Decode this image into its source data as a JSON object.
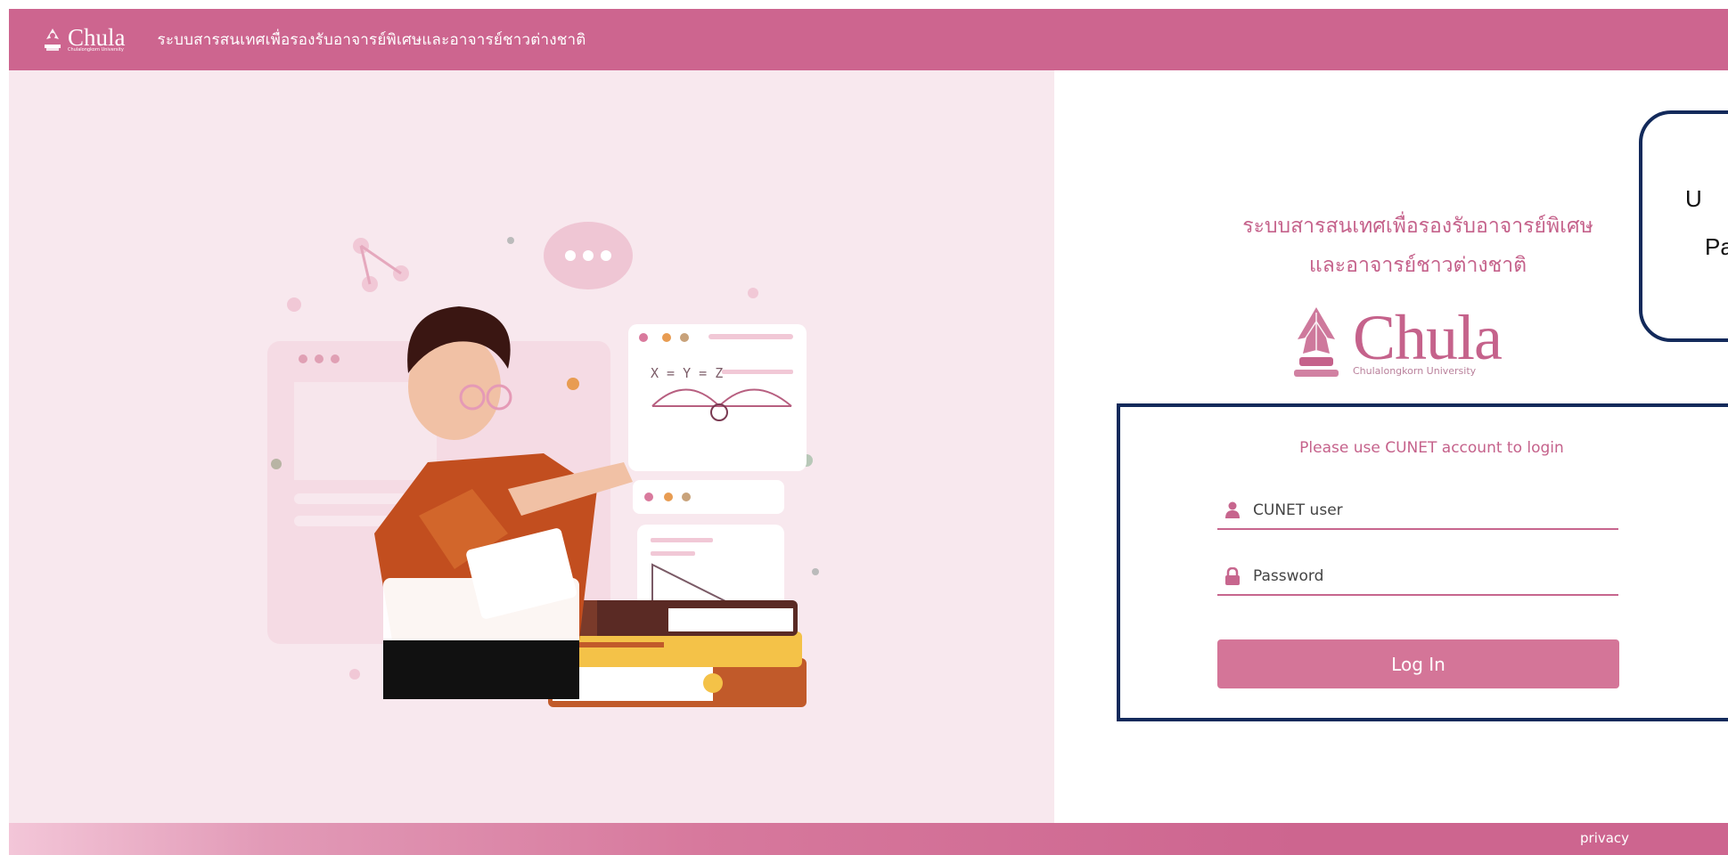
{
  "header": {
    "logo_text": "Chula",
    "logo_subtext": "Chulalongkorn University",
    "title": "ระบบสารสนเทศเพื่อรองรับอาจารย์พิเศษและอาจารย์ชาวต่างชาติ"
  },
  "illustration": {
    "formula_text": "X = Y = Z"
  },
  "main": {
    "title_line1": "ระบบสารสนเทศเพื่อรองรับอาจารย์พิเศษ",
    "title_line2": "และอาจารย์ชาวต่างชาติ",
    "logo_text": "Chula",
    "logo_subtext": "Chulalongkorn University"
  },
  "login": {
    "hint": "Please use CUNET account to login",
    "username_placeholder": "CUNET user",
    "username_value": "",
    "password_placeholder": "Password",
    "password_value": "",
    "login_button": "Log In",
    "user_icon": "user-icon",
    "lock_icon": "lock-icon"
  },
  "callout": {
    "line1": "U",
    "line2": "Pa"
  },
  "footer": {
    "privacy_link": "privacy"
  },
  "colors": {
    "brand_pink": "#cd658f",
    "panel_pink": "#f8e8ee",
    "button_pink": "#d47598",
    "box_navy": "#132a5b"
  }
}
